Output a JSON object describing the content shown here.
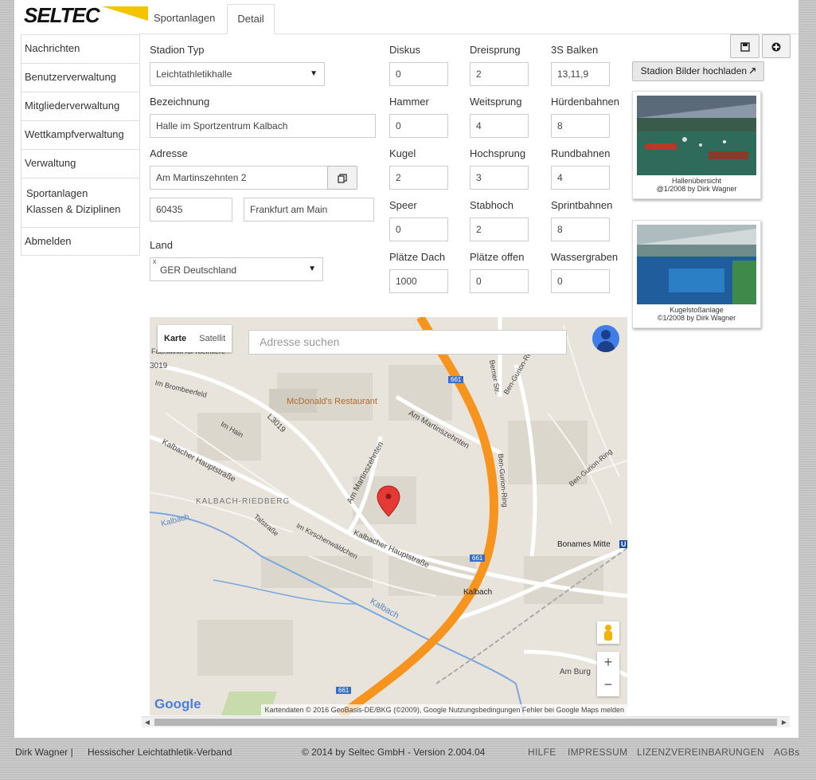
{
  "logo": {
    "text": "SELTEC"
  },
  "tabs": [
    {
      "label": "Sportanlagen"
    },
    {
      "label": "Detail"
    }
  ],
  "sidebar": {
    "items": [
      {
        "label": "Nachrichten"
      },
      {
        "label": "Benutzerverwaltung"
      },
      {
        "label": "Mitgliederverwaltung"
      },
      {
        "label": "Wettkampfverwaltung"
      },
      {
        "label": "Verwaltung"
      }
    ],
    "sub_items": [
      {
        "label": "Sportanlagen"
      },
      {
        "label": "Klassen & Diziplinen"
      }
    ],
    "logout": "Abmelden"
  },
  "form": {
    "stadion_typ": {
      "label": "Stadion Typ",
      "value": "Leichtathletikhalle"
    },
    "bezeichnung": {
      "label": "Bezeichnung",
      "value": "Halle im Sportzentrum Kalbach"
    },
    "adresse": {
      "label": "Adresse",
      "street": "Am Martinszehnten 2",
      "zip": "60435",
      "city": "Frankfurt am Main"
    },
    "land": {
      "label": "Land",
      "value": "GER Deutschland",
      "clear": "x"
    }
  },
  "facilities": [
    {
      "label": "Diskus",
      "value": "0"
    },
    {
      "label": "Dreisprung",
      "value": "2"
    },
    {
      "label": "3S Balken",
      "value": "13,11,9"
    },
    {
      "label": "Hammer",
      "value": "0"
    },
    {
      "label": "Weitsprung",
      "value": "4"
    },
    {
      "label": "Hürdenbahnen",
      "value": "8"
    },
    {
      "label": "Kugel",
      "value": "2"
    },
    {
      "label": "Hochsprung",
      "value": "3"
    },
    {
      "label": "Rundbahnen",
      "value": "4"
    },
    {
      "label": "Speer",
      "value": "0"
    },
    {
      "label": "Stabhoch",
      "value": "2"
    },
    {
      "label": "Sprintbahnen",
      "value": "8"
    },
    {
      "label": "Plätze Dach",
      "value": "1000"
    },
    {
      "label": "Plätze offen",
      "value": "0"
    },
    {
      "label": "Wassergraben",
      "value": "0"
    }
  ],
  "toolbar": {
    "save_icon": "save-icon",
    "add_icon": "plus-circle-icon"
  },
  "upload": {
    "label": "Stadion Bilder hochladen"
  },
  "photos": [
    {
      "caption": "Hallenübersicht",
      "credit": "@1/2008 by Dirk Wagner"
    },
    {
      "caption": "Kugelstoßanlage",
      "credit": "©1/2008 by Dirk Wagner"
    }
  ],
  "map": {
    "type_map": "Karte",
    "type_sat": "Satellit",
    "search_placeholder": "Adresse suchen",
    "labels": {
      "mcdonalds": "McDonald's Restaurant",
      "am_martinszehnten_1": "Am Martinszehnten",
      "am_martinszehnten_2": "Am Martinszehnten",
      "kalbach_riedberg": "KALBACH-RIEDBERG",
      "kalbacher_hauptstr_1": "Kalbacher Hauptstraße",
      "kalbacher_hauptstr_2": "Kalbacher Hauptstraße",
      "im_kirschenwaldchen": "Im Kirschenwäldchen",
      "talstrasse": "Talstraße",
      "kalbach_stream_1": "Kalbach",
      "kalbach_stream_2": "Kalbach",
      "im_brombeerfeld": "Im Brombeerfeld",
      "im_hain": "Im Hain",
      "l3019": "L3019",
      "r3019": "3019",
      "ben_gurion_1": "Ben-Gurion-Ring",
      "ben_gurion_2": "Ben-Gurion-Ring",
      "ben_gurion_3": "Ben-Gurion-Ring",
      "berner_str": "Berner Str.",
      "bonames_mitte": "Bonames Mitte",
      "kalbach_station": "Kalbach",
      "am_burg": "Am Burg",
      "fachklinik": "Fachklinik für Kleintiere",
      "route_661_1": "661",
      "route_661_2": "661",
      "route_661_3": "661",
      "u_sign": "U"
    },
    "attribution": "Kartendaten © 2016 GeoBasis-DE/BKG (©2009), Google    Nutzungsbedingungen    Fehler bei Google Maps melden",
    "google": "Google",
    "zoom_in": "+",
    "zoom_out": "−"
  },
  "footer": {
    "user": "Dirk Wagner |",
    "org": "Hessischer Leichtathletik-Verband",
    "copyright": "© 2014 by Seltec GmbH - Version 2.004.04",
    "links": [
      "HILFE",
      "IMPRESSUM",
      "LIZENZVEREINBARUNGEN",
      "AGBs"
    ]
  },
  "colors": {
    "highway": "#f6941d",
    "road": "#ffffff",
    "map_bg": "#e8e4dc",
    "marker": "#e53935",
    "water": "#6b9bd2",
    "logo_yellow": "#f3c400"
  }
}
